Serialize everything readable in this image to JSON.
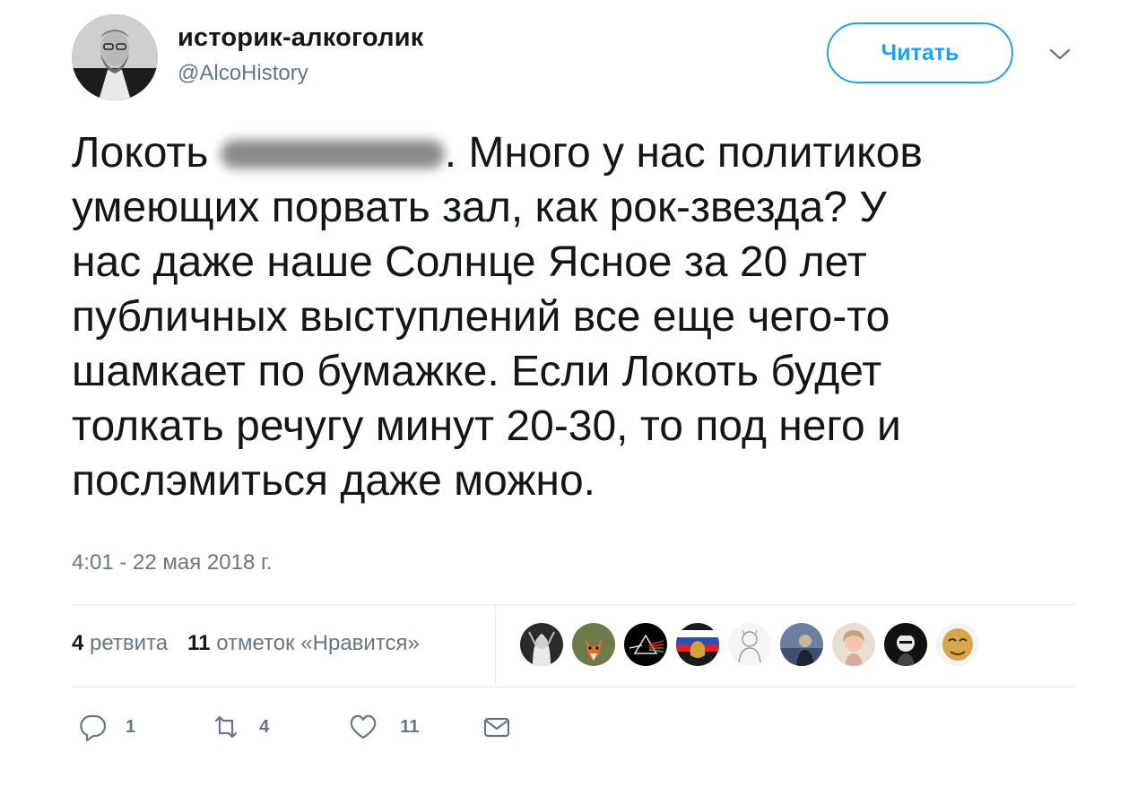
{
  "tweet": {
    "author_name": "историк-алкоголик",
    "author_handle": "@AlcoHistory",
    "follow_label": "Читать",
    "text_before_blur": "Локоть ",
    "text_after_blur": ". Много у нас политиков\nумеющих порвать зал, как рок-звезда? У\nнас даже наше Солнце Ясное за 20 лет\nпубличных выступлений все еще чего-то\nшамкает по бумажке. Если Локоть будет\nтолкать речугу минут 20-30, то под него и\nпослэмиться даже можно.",
    "timestamp": "4:01 - 22 мая 2018 г."
  },
  "stats": {
    "retweets_count": "4",
    "retweets_label": "ретвита",
    "likes_count": "11",
    "likes_label": "отметок «Нравится»"
  },
  "actions": {
    "reply_count": "1",
    "retweet_count": "4",
    "like_count": "11"
  },
  "colors": {
    "accent": "#1da1f2",
    "muted": "#657786",
    "divider": "#e6ecf0"
  }
}
